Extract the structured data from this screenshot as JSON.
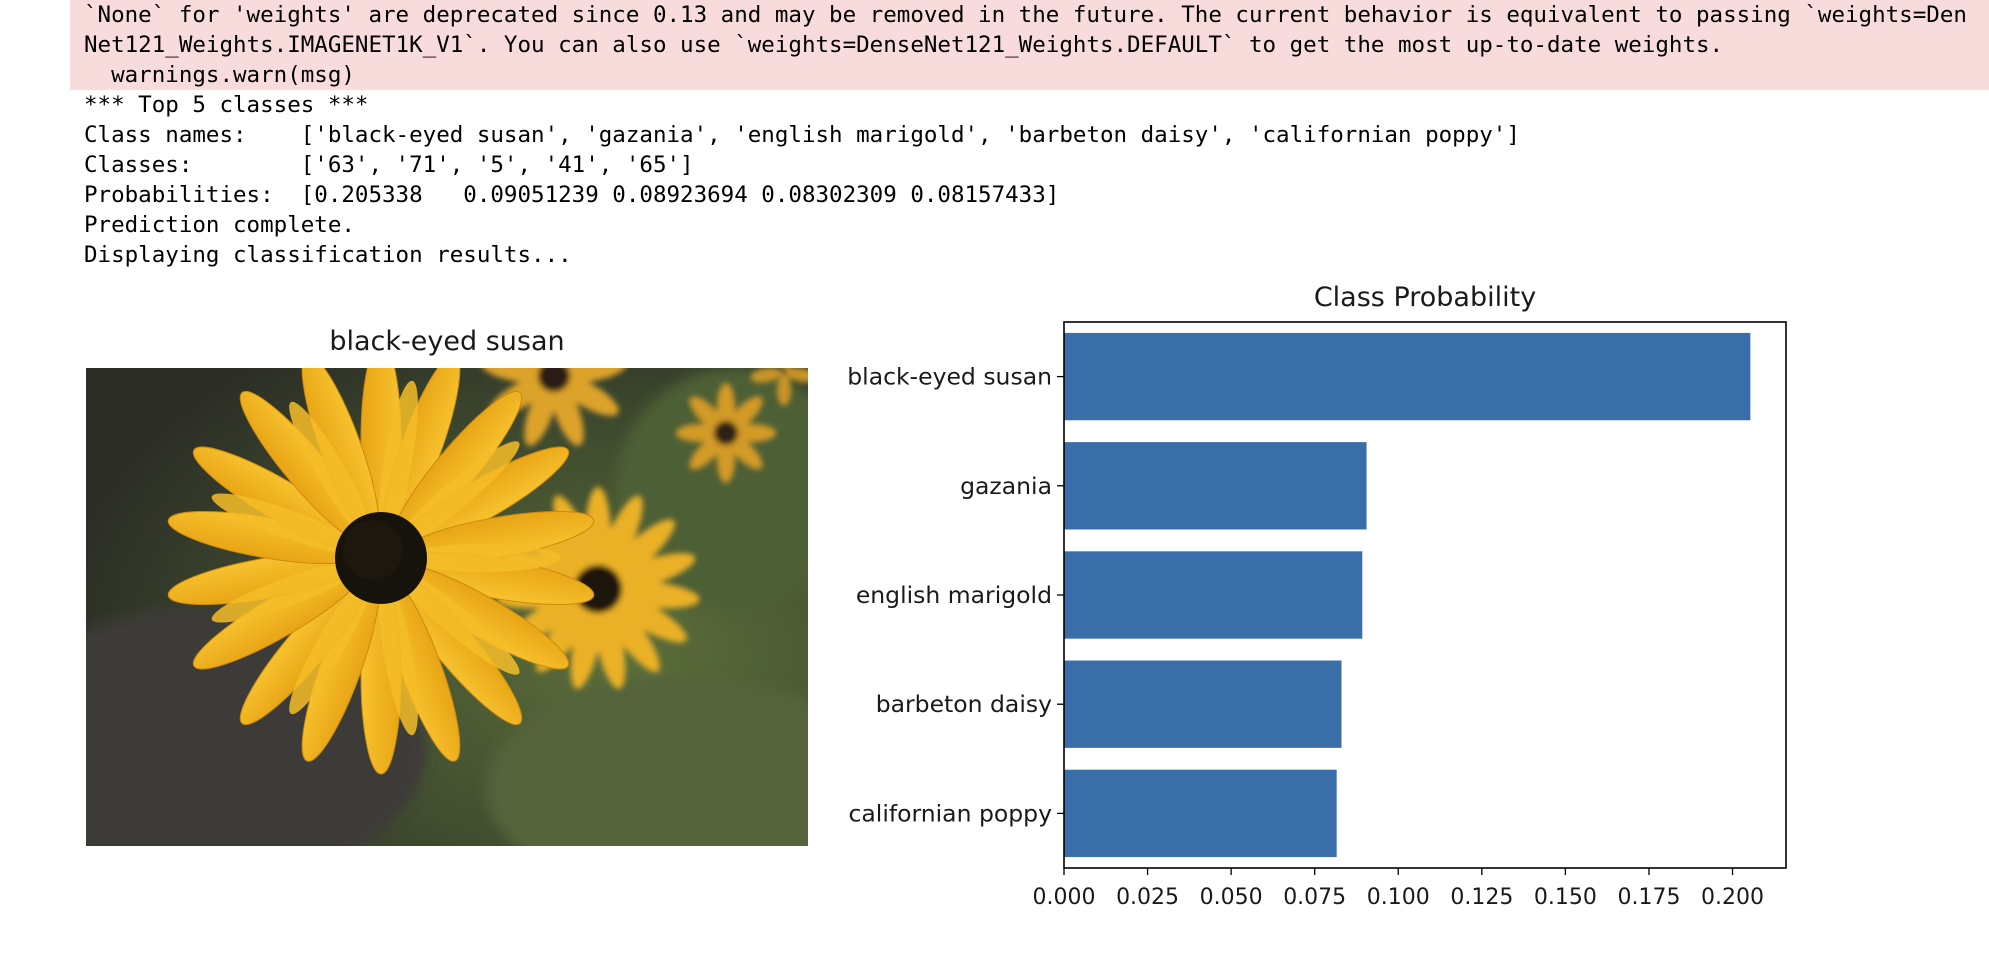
{
  "output": {
    "warning_lines": [
      "`None` for 'weights' are deprecated since 0.13 and may be removed in the future. The current behavior is equivalent to passing `weights=Den",
      "Net121_Weights.IMAGENET1K_V1`. You can also use `weights=DenseNet121_Weights.DEFAULT` to get the most up-to-date weights.",
      "  warnings.warn(msg)"
    ],
    "lines": [
      "*** Top 5 classes ***",
      "Class names:    ['black-eyed susan', 'gazania', 'english marigold', 'barbeton daisy', 'californian poppy']",
      "Classes:        ['63', '71', '5', '41', '65']",
      "Probabilities:  [0.205338   0.09051239 0.08923694 0.08302309 0.08157433]",
      "Prediction complete.",
      "Displaying classification results..."
    ]
  },
  "image_panel": {
    "title": "black-eyed susan"
  },
  "chart_data": {
    "type": "bar",
    "orientation": "horizontal",
    "title": "Class Probability",
    "xlabel": "",
    "ylabel": "",
    "categories": [
      "black-eyed susan",
      "gazania",
      "english marigold",
      "barbeton daisy",
      "californian poppy"
    ],
    "values": [
      0.205338,
      0.09051239,
      0.08923694,
      0.08302309,
      0.08157433
    ],
    "xlim": [
      0,
      0.216
    ],
    "xticks": [
      "0.000",
      "0.025",
      "0.050",
      "0.075",
      "0.100",
      "0.125",
      "0.150",
      "0.175",
      "0.200"
    ],
    "bar_color": "#3a6ea8",
    "grid": false
  }
}
